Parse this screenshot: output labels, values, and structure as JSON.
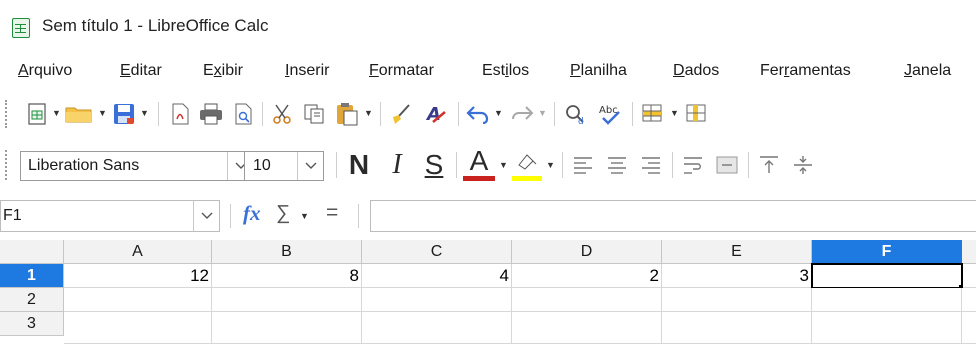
{
  "window": {
    "title": "Sem título 1 - LibreOffice Calc"
  },
  "menu": [
    {
      "label": "Arquivo",
      "key": "A",
      "rest": "rquivo"
    },
    {
      "label": "Editar",
      "key": "E",
      "rest": "ditar"
    },
    {
      "label": "Exibir",
      "key": "x",
      "pre": "E",
      "rest": "ibir"
    },
    {
      "label": "Inserir",
      "key": "I",
      "rest": "nserir"
    },
    {
      "label": "Formatar",
      "key": "F",
      "rest": "ormatar"
    },
    {
      "label": "Estilos",
      "key": "i",
      "pre": "Est",
      "rest": "los"
    },
    {
      "label": "Planilha",
      "key": "P",
      "rest": "lanilha"
    },
    {
      "label": "Dados",
      "key": "D",
      "rest": "ados"
    },
    {
      "label": "Ferramentas",
      "key": "r",
      "pre": "Fer",
      "rest": "amentas"
    },
    {
      "label": "Janela",
      "key": "J",
      "rest": "anela"
    }
  ],
  "toolbar": {
    "standard_icons": [
      "new-spreadsheet-icon",
      "open-folder-icon",
      "save-icon",
      "export-pdf-icon",
      "print-icon",
      "print-preview-icon",
      "cut-icon",
      "copy-icon",
      "paste-icon",
      "clone-formatting-icon",
      "clear-formatting-icon",
      "undo-icon",
      "redo-icon",
      "find-replace-icon",
      "spelling-icon",
      "row-icon",
      "column-icon"
    ],
    "font_name": "Liberation Sans",
    "font_size": "10",
    "bold_glyph": "N",
    "italic_glyph": "I",
    "underline_glyph": "S",
    "font_color_glyph": "A",
    "font_color": "#c9211e",
    "highlight_color": "#ffff00"
  },
  "formula_bar": {
    "name_box": "F1",
    "function_wizard": "fx",
    "sum_glyph": "∑",
    "equals_glyph": "=",
    "content": ""
  },
  "sheet": {
    "columns": [
      "A",
      "B",
      "C",
      "D",
      "E",
      "F"
    ],
    "rows": [
      "1",
      "2",
      "3"
    ],
    "row1_values": [
      "12",
      "8",
      "4",
      "2",
      "3",
      ""
    ],
    "active_cell": "F1",
    "selection_color": "#1e7ae0"
  }
}
